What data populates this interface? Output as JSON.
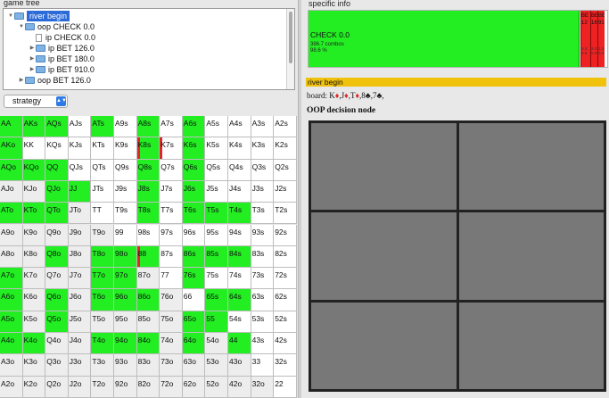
{
  "left_panel": {
    "title": "game tree",
    "tree": [
      {
        "label": "river begin",
        "level": 0,
        "expanded": true,
        "selected": true,
        "icon": "folder-icon"
      },
      {
        "label": "oop CHECK 0.0",
        "level": 1,
        "expanded": true,
        "icon": "folder-icon"
      },
      {
        "label": "ip CHECK 0.0",
        "level": 2,
        "leaf": true,
        "icon": "document-icon"
      },
      {
        "label": "ip BET 126.0",
        "level": 2,
        "expanded": false,
        "icon": "folder-icon"
      },
      {
        "label": "ip BET 180.0",
        "level": 2,
        "expanded": false,
        "icon": "folder-icon"
      },
      {
        "label": "ip BET 910.0",
        "level": 2,
        "expanded": false,
        "icon": "folder-icon"
      },
      {
        "label": "oop BET 126.0",
        "level": 1,
        "expanded": false,
        "icon": "folder-icon"
      }
    ],
    "view_select": {
      "value": "strategy"
    },
    "hand_grid": [
      [
        "AA",
        "AKs",
        "AQs",
        "AJs",
        "ATs",
        "A9s",
        "A8s",
        "A7s",
        "A6s",
        "A5s",
        "A4s",
        "A3s",
        "A2s"
      ],
      [
        "AKo",
        "KK",
        "KQs",
        "KJs",
        "KTs",
        "K9s",
        "K8s",
        "K7s",
        "K6s",
        "K5s",
        "K4s",
        "K3s",
        "K2s"
      ],
      [
        "AQo",
        "KQo",
        "QQ",
        "QJs",
        "QTs",
        "Q9s",
        "Q8s",
        "Q7s",
        "Q6s",
        "Q5s",
        "Q4s",
        "Q3s",
        "Q2s"
      ],
      [
        "AJo",
        "KJo",
        "QJo",
        "JJ",
        "JTs",
        "J9s",
        "J8s",
        "J7s",
        "J6s",
        "J5s",
        "J4s",
        "J3s",
        "J2s"
      ],
      [
        "ATo",
        "KTo",
        "QTo",
        "JTo",
        "TT",
        "T9s",
        "T8s",
        "T7s",
        "T6s",
        "T5s",
        "T4s",
        "T3s",
        "T2s"
      ],
      [
        "A9o",
        "K9o",
        "Q9o",
        "J9o",
        "T9o",
        "99",
        "98s",
        "97s",
        "96s",
        "95s",
        "94s",
        "93s",
        "92s"
      ],
      [
        "A8o",
        "K8o",
        "Q8o",
        "J8o",
        "T8o",
        "98o",
        "88",
        "87s",
        "86s",
        "85s",
        "84s",
        "83s",
        "82s"
      ],
      [
        "A7o",
        "K7o",
        "Q7o",
        "J7o",
        "T7o",
        "97o",
        "87o",
        "77",
        "76s",
        "75s",
        "74s",
        "73s",
        "72s"
      ],
      [
        "A6o",
        "K6o",
        "Q6o",
        "J6o",
        "T6o",
        "96o",
        "86o",
        "76o",
        "66",
        "65s",
        "64s",
        "63s",
        "62s"
      ],
      [
        "A5o",
        "K5o",
        "Q5o",
        "J5o",
        "T5o",
        "95o",
        "85o",
        "75o",
        "65o",
        "55",
        "54s",
        "53s",
        "52s"
      ],
      [
        "A4o",
        "K4o",
        "Q4o",
        "J4o",
        "T4o",
        "94o",
        "84o",
        "74o",
        "64o",
        "54o",
        "44",
        "43s",
        "42s"
      ],
      [
        "A3o",
        "K3o",
        "Q3o",
        "J3o",
        "T3o",
        "93o",
        "83o",
        "73o",
        "63o",
        "53o",
        "43o",
        "33",
        "32s"
      ],
      [
        "A2o",
        "K2o",
        "Q2o",
        "J2o",
        "T2o",
        "92o",
        "82o",
        "72o",
        "62o",
        "52o",
        "42o",
        "32o",
        "22"
      ]
    ],
    "green_hands": [
      "AA",
      "AKs",
      "AQs",
      "ATs",
      "A8s",
      "A6s",
      "AKo",
      "K8s",
      "K6s",
      "AQo",
      "KQo",
      "QQ",
      "Q8s",
      "Q6s",
      "QJo",
      "JJ",
      "J8s",
      "J6s",
      "ATo",
      "KTo",
      "QTo",
      "T8s",
      "T6s",
      "T5s",
      "T4s",
      "Q8o",
      "T8o",
      "98o",
      "88",
      "86s",
      "85s",
      "84s",
      "A7o",
      "T7o",
      "97o",
      "76s",
      "A6o",
      "Q6o",
      "T6o",
      "96o",
      "86o",
      "65s",
      "64s",
      "A5o",
      "Q5o",
      "65o",
      "55",
      "A4o",
      "K4o",
      "T4o",
      "94o",
      "84o",
      "64o",
      "44"
    ],
    "red_marks": [
      "K8s",
      "K7s",
      "88"
    ],
    "colors": {
      "check": "#22ee22",
      "bet": "#ee2222",
      "highlight": "#f0c20c"
    }
  },
  "right_panel": {
    "title": "specific info",
    "strategy_bars": {
      "check": {
        "label": "CHECK 0.0",
        "combos": "386.7 combos",
        "pct": "98.6 %",
        "share": 0.906
      },
      "bets": [
        {
          "label": "BE\n12",
          "sub": "3.3\n0.8",
          "share": 0.032
        },
        {
          "label": "BE\n18",
          "sub": "3.3\n0.8",
          "share": 0.025
        },
        {
          "label": "BE\n91",
          "sub": "1.3\n0.3",
          "share": 0.024
        }
      ]
    },
    "node_label": "river begin",
    "board": {
      "prefix": "board:",
      "cards": [
        {
          "rank": "K",
          "suit": "♦",
          "red": true
        },
        {
          "rank": "J",
          "suit": "♦",
          "red": true
        },
        {
          "rank": "T",
          "suit": "♦",
          "red": true
        },
        {
          "rank": "8",
          "suit": "♣",
          "red": false
        },
        {
          "rank": "7",
          "suit": "♣",
          "red": false
        }
      ]
    },
    "decision_label": "OOP decision node"
  }
}
